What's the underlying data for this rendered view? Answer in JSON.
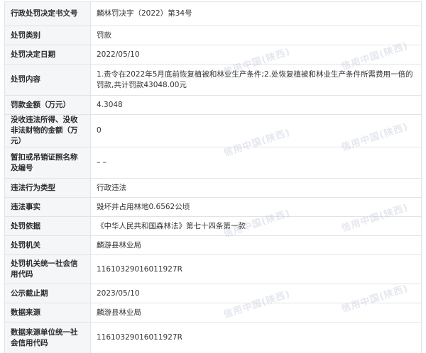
{
  "rows": [
    {
      "label": "行政处罚决定书文号",
      "value": "麟林罚决字（2022）第34号"
    },
    {
      "label": "处罚类别",
      "value": "罚款"
    },
    {
      "label": "处罚决定日期",
      "value": "2022/05/10"
    },
    {
      "label": "处罚内容",
      "value": "1.责令在2022年5月底前恢复植被和林业生产条件;2.处恢复植被和林业生产条件所需费用一倍的罚款,共计罚款43048.00元"
    },
    {
      "label": "罚款金额（万元）",
      "value": "4.3048"
    },
    {
      "label": "没收违法所得、没收非法财物的金额（万元）",
      "value": "0"
    },
    {
      "label": "暂扣或吊销证照名称及编号",
      "value": "– –"
    },
    {
      "label": "违法行为类型",
      "value": "行政违法"
    },
    {
      "label": "违法事实",
      "value": "毁坏并占用林地0.6562公顷"
    },
    {
      "label": "处罚依据",
      "value": "《中华人民共和国森林法》第七十四条第一款"
    },
    {
      "label": "处罚机关",
      "value": "麟游县林业局"
    },
    {
      "label": "处罚机关统一社会信用代码",
      "value": "11610329016011927R"
    },
    {
      "label": "公示截止期",
      "value": "2023/05/10"
    },
    {
      "label": "数据来源",
      "value": "麟游县林业局"
    },
    {
      "label": "数据来源单位统一社会信用代码",
      "value": "11610329016011927R"
    }
  ],
  "watermark": {
    "text": "信用中国(陕西)"
  }
}
